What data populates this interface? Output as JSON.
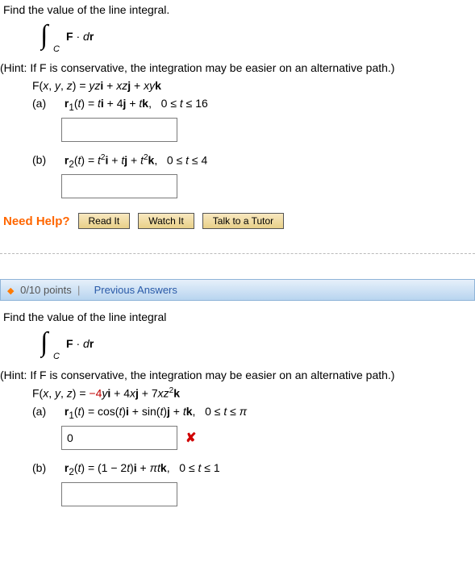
{
  "q1": {
    "prompt": "Find the value of the line integral.",
    "integral_text": "F · dr",
    "hint": "(Hint: If F is conservative, the integration may be easier on an alternative path.)",
    "field": "F(x, y, z) = yzi + xzj + xyk",
    "parts": {
      "a": {
        "label": "(a)",
        "eq": "r₁(t) = ti + 4j + tk,   0 ≤ t ≤ 16",
        "value": ""
      },
      "b": {
        "label": "(b)",
        "eq": "r₂(t) = t²i + tj + t²k,   0 ≤ t ≤ 4",
        "value": ""
      }
    },
    "help": {
      "label": "Need Help?",
      "read": "Read It",
      "watch": "Watch It",
      "tutor": "Talk to a Tutor"
    }
  },
  "q2": {
    "header_points": "0/10 points",
    "header_prev": "Previous Answers",
    "prompt": "Find the value of the line integral",
    "integral_text": "F · dr",
    "hint": "(Hint: If F is conservative, the integration may be easier on an alternative path.)",
    "field_html": "F(x, y, z) = −4yi + 4xj + 7xz²k",
    "parts": {
      "a": {
        "label": "(a)",
        "eq": "r₁(t) = cos(t)i + sin(t)j + tk,   0 ≤ t ≤ π",
        "value": "0",
        "wrong": "✘"
      },
      "b": {
        "label": "(b)",
        "eq": "r₂(t) = (1 − 2t)i + πtk,   0 ≤ t ≤ 1",
        "value": ""
      }
    }
  }
}
